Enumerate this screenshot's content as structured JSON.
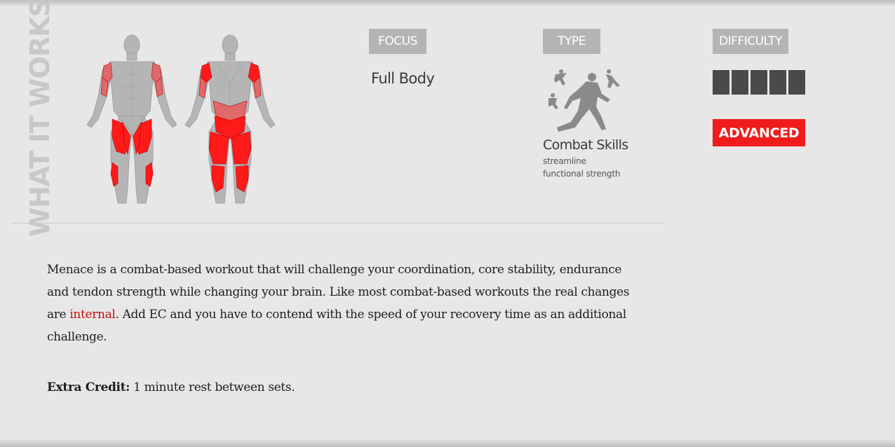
{
  "section": {
    "title": "WHAT IT WORKS"
  },
  "focus": {
    "label": "FOCUS",
    "value": "Full Body"
  },
  "type": {
    "label": "TYPE",
    "name": "Combat Skills",
    "subtitle_lines": [
      "streamline",
      "functional strength"
    ],
    "icon": "combat-figure-icon"
  },
  "difficulty": {
    "label": "DIFFICULTY",
    "blocks_filled": 5,
    "blocks_total": 5,
    "level": "ADVANCED",
    "level_color": "#ee1c1c"
  },
  "description": {
    "before_highlight": "Menace is a combat-based workout that will challenge your coordination, core stability, endurance and tendon strength while changing your brain. Like most combat-based workouts the real changes are ",
    "highlight": "internal",
    "after_highlight": ". Add EC and you have to contend with the speed of your recovery time as an additional challenge."
  },
  "extra_credit": {
    "label": "Extra Credit:",
    "text": " 1 minute rest between sets."
  },
  "colors": {
    "background": "#e7e7e7",
    "label_box": "#b4b4b4",
    "muscle_active": "#ff1a1a",
    "muscle_secondary": "#e06a6a",
    "body_gray": "#b5b5b5"
  }
}
